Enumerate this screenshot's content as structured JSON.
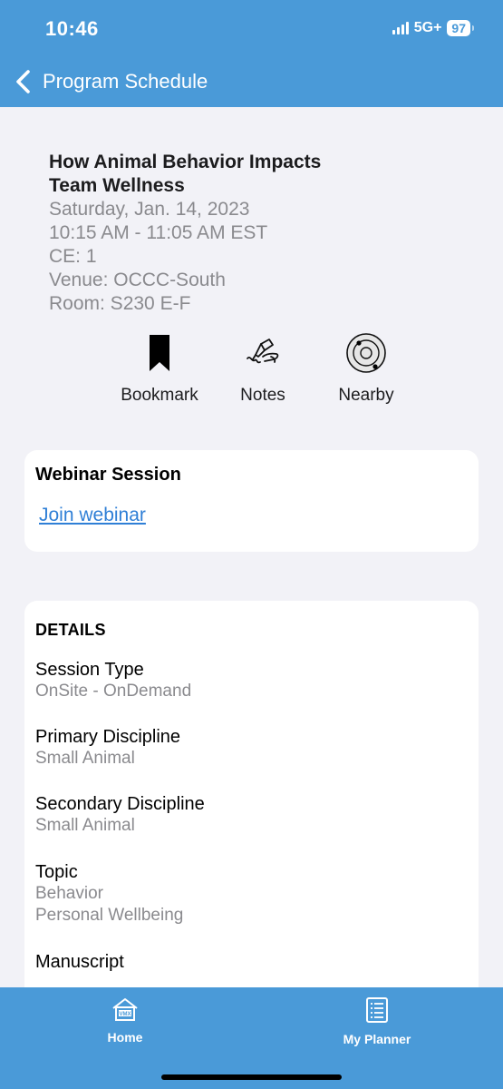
{
  "status_bar": {
    "time": "10:46",
    "network": "5G+",
    "battery": "97"
  },
  "header": {
    "back_icon": "chevron-left-icon",
    "title": "Program Schedule"
  },
  "session": {
    "title_line1": "How Animal Behavior Impacts",
    "title_line2": "Team Wellness",
    "date": "Saturday, Jan. 14, 2023",
    "time": "10:15 AM - 11:05 AM EST",
    "ce": "CE: 1",
    "venue": "Venue: OCCC-South",
    "room": "Room: S230 E-F"
  },
  "actions": [
    {
      "label": "Bookmark",
      "icon": "bookmark-icon"
    },
    {
      "label": "Notes",
      "icon": "pen-writing-icon"
    },
    {
      "label": "Nearby",
      "icon": "location-radar-icon"
    }
  ],
  "webinar": {
    "heading": "Webinar Session",
    "link": "Join webinar"
  },
  "details": {
    "heading": "DETAILS",
    "session_type_label": "Session Type",
    "session_type_value": "OnSite - OnDemand",
    "primary_label": "Primary Discipline",
    "primary_value": "Small Animal",
    "secondary_label": "Secondary Discipline",
    "secondary_value": "Small Animal",
    "topic_label": "Topic",
    "topic_values": [
      "Behavior",
      "Personal Wellbeing"
    ],
    "manuscript_label": "Manuscript"
  },
  "tabbar": {
    "home_label": "Home",
    "home_icon": "vmx-house-icon",
    "planner_label": "My Planner",
    "planner_icon": "planner-list-icon"
  },
  "colors": {
    "brand_blue": "#4a9ad8",
    "link_blue": "#2f7fd6",
    "secondary_text": "#8a8a8e",
    "background": "#f2f2f7"
  }
}
